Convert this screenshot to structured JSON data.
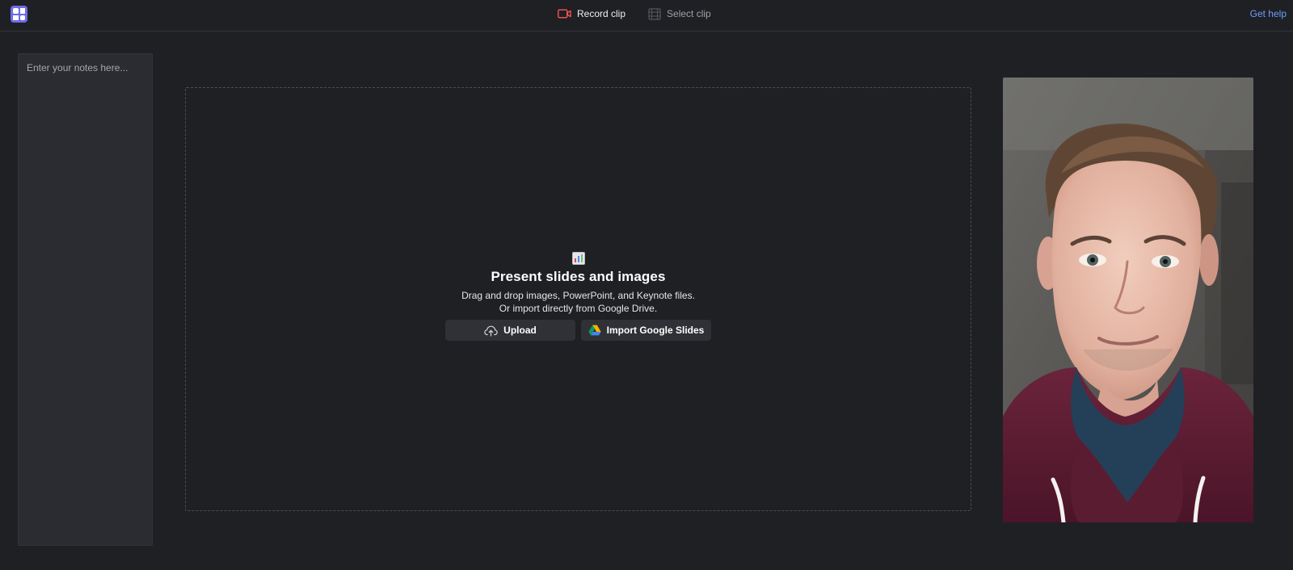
{
  "header": {
    "record_label": "Record clip",
    "select_label": "Select clip",
    "help_label": "Get help"
  },
  "notes": {
    "placeholder": "Enter your notes here..."
  },
  "dropzone": {
    "icon": "bar-chart-icon",
    "title": "Present slides and images",
    "description_line1": "Drag and drop images, PowerPoint, and Keynote files.",
    "description_line2": "Or import directly from Google Drive.",
    "upload_label": "Upload",
    "google_slides_label": "Import Google Slides"
  },
  "camera": {
    "description": "webcam feed"
  },
  "colors": {
    "background": "#1f2024",
    "panel": "#2b2c31",
    "accent": "#6f6ce8",
    "link": "#6f9cff",
    "record_red": "#ff5656"
  }
}
